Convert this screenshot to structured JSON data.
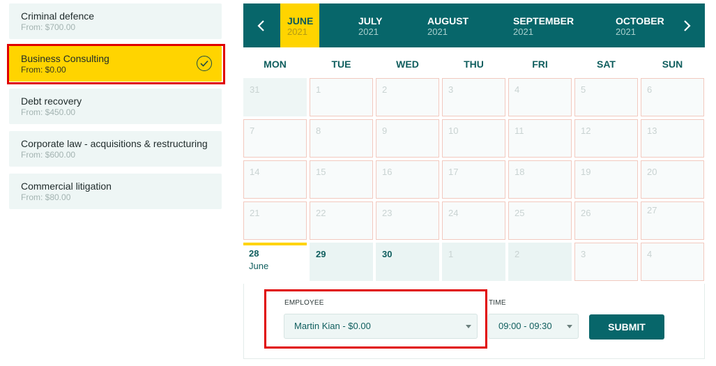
{
  "services": [
    {
      "name": "Criminal defence",
      "price": "From: $700.00",
      "selected": false
    },
    {
      "name": "Business Consulting",
      "price": "From: $0.00",
      "selected": true
    },
    {
      "name": "Debt recovery",
      "price": "From: $450.00",
      "selected": false
    },
    {
      "name": "Corporate law - acquisitions & restructuring",
      "price": "From: $600.00",
      "selected": false
    },
    {
      "name": "Commercial litigation",
      "price": "From: $80.00",
      "selected": false
    }
  ],
  "calendar": {
    "months": [
      {
        "name": "JUNE",
        "year": "2021",
        "active": true
      },
      {
        "name": "JULY",
        "year": "2021"
      },
      {
        "name": "AUGUST",
        "year": "2021"
      },
      {
        "name": "SEPTEMBER",
        "year": "2021"
      },
      {
        "name": "OCTOBER",
        "year": "2021"
      }
    ],
    "weekdays": [
      "MON",
      "TUE",
      "WED",
      "THU",
      "FRI",
      "SAT",
      "SUN"
    ],
    "rows": [
      [
        "31",
        "1",
        "2",
        "3",
        "4",
        "5",
        "6"
      ],
      [
        "7",
        "8",
        "9",
        "10",
        "11",
        "12",
        "13"
      ],
      [
        "14",
        "15",
        "16",
        "17",
        "18",
        "19",
        "20"
      ],
      [
        "21",
        "22",
        "23",
        "24",
        "25",
        "26",
        "27"
      ],
      [
        "28",
        "29",
        "30",
        "1",
        "2",
        "3",
        "4"
      ]
    ],
    "selected_day": {
      "day": "28",
      "month": "June"
    }
  },
  "booking": {
    "employee_label": "EMPLOYEE",
    "employee_value": "Martin Kian - $0.00",
    "time_label": "TIME",
    "time_value": "09:00 - 09:30",
    "submit_label": "SUBMIT"
  },
  "colors": {
    "primary": "#07666a",
    "accent": "#ffd400",
    "highlight_box": "#e00000"
  }
}
